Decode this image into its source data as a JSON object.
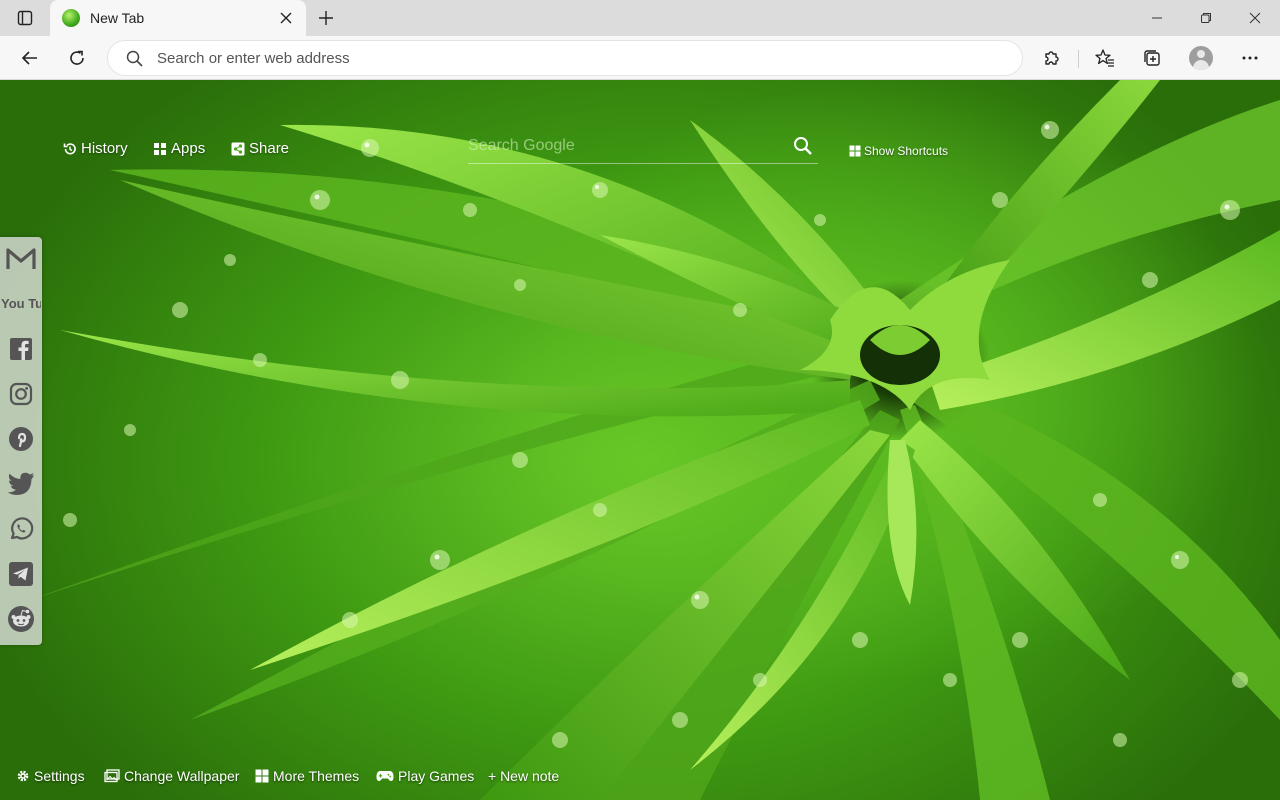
{
  "browser": {
    "tab": {
      "title": "New Tab"
    },
    "address_bar": {
      "placeholder": "Search or enter web address"
    }
  },
  "newtab": {
    "top_links": {
      "history": "History",
      "apps": "Apps",
      "share": "Share"
    },
    "search": {
      "placeholder": "Search Google"
    },
    "shortcuts_label": "Show Shortcuts",
    "social_icons": [
      "gmail-icon",
      "youtube-icon",
      "facebook-icon",
      "instagram-icon",
      "pinterest-icon",
      "twitter-icon",
      "whatsapp-icon",
      "telegram-icon",
      "reddit-icon"
    ],
    "youtube_text": "You Tube",
    "bottom_links": {
      "settings": "Settings",
      "change_wallpaper": "Change Wallpaper",
      "more_themes": "More Themes",
      "play_games": "Play Games",
      "new_note": "+ New note"
    }
  },
  "colors": {
    "wallpaper_green": "#4caf1a",
    "titlebar": "#dcdcdc",
    "toolbar": "#f7f7f7"
  }
}
